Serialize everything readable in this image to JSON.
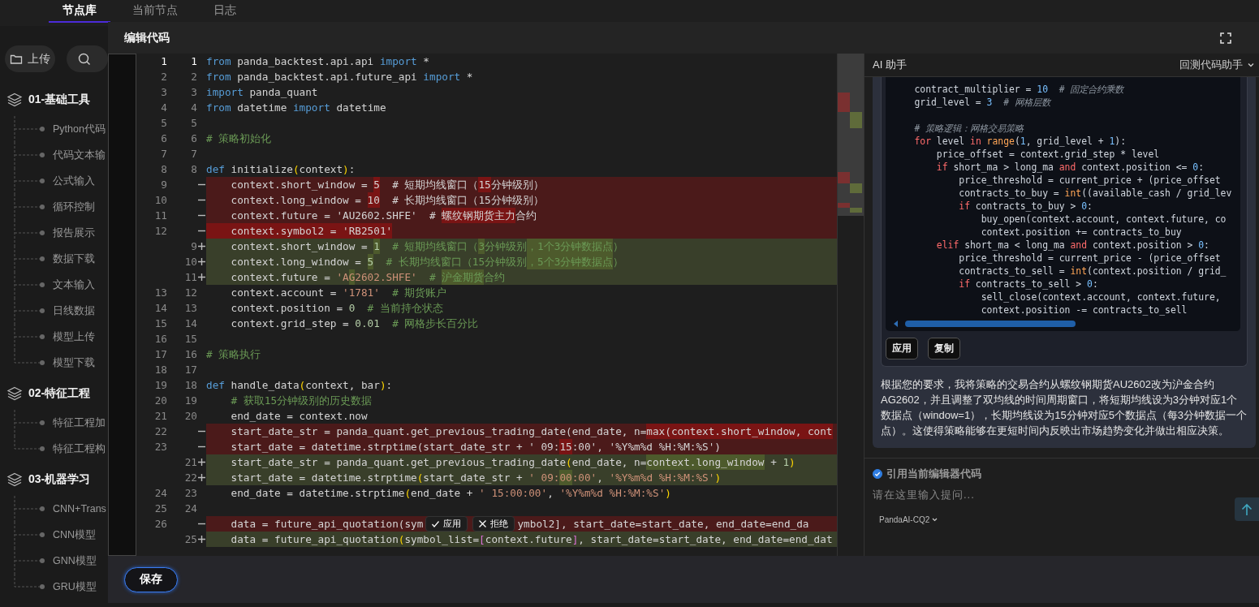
{
  "top_tabs": [
    {
      "label": "节点库",
      "selected": true
    },
    {
      "label": "当前节点",
      "selected": false
    },
    {
      "label": "日志",
      "selected": false
    }
  ],
  "sidebar": {
    "upload_button": "上传",
    "groups": [
      {
        "title": "01-基础工具",
        "children": [
          {
            "label": "Python代码"
          },
          {
            "label": "代码文本输"
          },
          {
            "label": "公式输入"
          },
          {
            "label": "循环控制"
          },
          {
            "label": "报告展示"
          },
          {
            "label": "数据下载"
          },
          {
            "label": "文本输入"
          },
          {
            "label": "日线数据"
          },
          {
            "label": "模型上传"
          },
          {
            "label": "模型下载"
          }
        ]
      },
      {
        "title": "02-特征工程",
        "children": [
          {
            "label": "特征工程加"
          },
          {
            "label": "特征工程构"
          }
        ]
      },
      {
        "title": "03-机器学习",
        "children": [
          {
            "label": "CNN+Trans"
          },
          {
            "label": "CNN模型"
          },
          {
            "label": "GNN模型"
          },
          {
            "label": "GRU模型"
          }
        ]
      }
    ]
  },
  "modal": {
    "title": "编辑代码",
    "save_button": "保存",
    "editor": {
      "lines": [
        {
          "old": "1",
          "new": "1",
          "kind": "context",
          "segs": [
            {
              "kind": "kw",
              "t": "from"
            },
            {
              "kind": "p",
              "t": " panda_backtest.api.api "
            },
            {
              "kind": "kw",
              "t": "import"
            },
            {
              "kind": "p",
              "t": " *"
            }
          ]
        },
        {
          "old": "2",
          "new": "2",
          "kind": "context",
          "segs": [
            {
              "kind": "kw",
              "t": "from"
            },
            {
              "kind": "p",
              "t": " panda_backtest.api.future_api "
            },
            {
              "kind": "kw",
              "t": "import"
            },
            {
              "kind": "p",
              "t": " *"
            }
          ]
        },
        {
          "old": "3",
          "new": "3",
          "kind": "context",
          "segs": [
            {
              "kind": "kw",
              "t": "import"
            },
            {
              "kind": "p",
              "t": " panda_quant"
            }
          ]
        },
        {
          "old": "4",
          "new": "4",
          "kind": "context",
          "segs": [
            {
              "kind": "kw",
              "t": "from"
            },
            {
              "kind": "p",
              "t": " datetime "
            },
            {
              "kind": "kw",
              "t": "import"
            },
            {
              "kind": "p",
              "t": " datetime"
            }
          ]
        },
        {
          "old": "5",
          "new": "5",
          "kind": "context"
        },
        {
          "old": "6",
          "new": "6",
          "kind": "context",
          "segs": [
            {
              "kind": "cmt",
              "t": "# 策略初始化"
            }
          ]
        },
        {
          "old": "7",
          "new": "7",
          "kind": "context"
        },
        {
          "old": "8",
          "new": "8",
          "kind": "context",
          "segs": [
            {
              "kind": "kw",
              "t": "def"
            },
            {
              "kind": "p",
              "t": " initialize"
            },
            {
              "kind": "br",
              "t": "("
            },
            {
              "kind": "p",
              "t": "context"
            },
            {
              "kind": "br",
              "t": ")"
            },
            {
              "kind": "p",
              "t": ":"
            }
          ]
        },
        {
          "old": "9",
          "kind": "removed",
          "segs": [
            {
              "kind": "p",
              "t": "    context.short_window = "
            },
            {
              "kind": "p",
              "t": "5",
              "hl": true
            },
            {
              "kind": "p",
              "t": "  # 短期均线窗口（"
            },
            {
              "kind": "p",
              "t": "15",
              "hl": true
            },
            {
              "kind": "p",
              "t": "分钟级别）"
            }
          ]
        },
        {
          "old": "10",
          "kind": "removed",
          "segs": [
            {
              "kind": "p",
              "t": "    context.long_window = "
            },
            {
              "kind": "p",
              "t": "10",
              "hl": true
            },
            {
              "kind": "p",
              "t": "  # 长期均线窗口（15分钟级别）"
            }
          ]
        },
        {
          "old": "11",
          "kind": "removed",
          "segs": [
            {
              "kind": "p",
              "t": "    context.future = 'AU2602.SHFE'  # "
            },
            {
              "kind": "p",
              "t": "螺纹钢期货主力",
              "hl": true
            },
            {
              "kind": "p",
              "t": "合约"
            }
          ]
        },
        {
          "old": "12",
          "kind": "removed",
          "segs": [
            {
              "kind": "p",
              "t": "    context.symbol2 = 'RB2501'",
              "hl": true
            }
          ]
        },
        {
          "new": "9",
          "kind": "added",
          "segs": [
            {
              "kind": "p",
              "t": "    context.short_window = "
            },
            {
              "kind": "num",
              "t": "1",
              "hl": true
            },
            {
              "kind": "cmt",
              "t": "  # 短期均线窗口（"
            },
            {
              "kind": "cmt",
              "t": "3",
              "hl": true
            },
            {
              "kind": "cmt",
              "t": "分钟级别"
            },
            {
              "kind": "cmt",
              "t": "，1个3分钟数据点",
              "hl": true
            },
            {
              "kind": "cmt",
              "t": "）"
            }
          ]
        },
        {
          "new": "10",
          "kind": "added",
          "segs": [
            {
              "kind": "p",
              "t": "    context.long_window = "
            },
            {
              "kind": "num",
              "t": "5",
              "hl": true
            },
            {
              "kind": "cmt",
              "t": "  # 长期均线窗口（15分钟级别"
            },
            {
              "kind": "cmt",
              "t": "，5个3分钟数据点",
              "hl": true
            },
            {
              "kind": "cmt",
              "t": "）"
            }
          ]
        },
        {
          "new": "11",
          "kind": "added",
          "segs": [
            {
              "kind": "p",
              "t": "    context.future = "
            },
            {
              "kind": "str",
              "t": "'A"
            },
            {
              "kind": "str",
              "t": "G",
              "hl": true
            },
            {
              "kind": "str",
              "t": "2602.SHFE'"
            },
            {
              "kind": "cmt",
              "t": "  # "
            },
            {
              "kind": "cmt",
              "t": "沪金期货",
              "hl": true
            },
            {
              "kind": "cmt",
              "t": "合约"
            }
          ]
        },
        {
          "old": "13",
          "new": "12",
          "kind": "context",
          "segs": [
            {
              "kind": "p",
              "t": "    context.account = "
            },
            {
              "kind": "str",
              "t": "'1781'"
            },
            {
              "kind": "cmt",
              "t": "  # 期货账户"
            }
          ]
        },
        {
          "old": "14",
          "new": "13",
          "kind": "context",
          "segs": [
            {
              "kind": "p",
              "t": "    context.position = "
            },
            {
              "kind": "num",
              "t": "0"
            },
            {
              "kind": "cmt",
              "t": "  # 当前持仓状态"
            }
          ]
        },
        {
          "old": "15",
          "new": "14",
          "kind": "context",
          "segs": [
            {
              "kind": "p",
              "t": "    context.grid_step = "
            },
            {
              "kind": "num",
              "t": "0.01"
            },
            {
              "kind": "cmt",
              "t": "  # 网格步长百分比"
            }
          ]
        },
        {
          "old": "16",
          "new": "15",
          "kind": "context"
        },
        {
          "old": "17",
          "new": "16",
          "kind": "context",
          "segs": [
            {
              "kind": "cmt",
              "t": "# 策略执行"
            }
          ]
        },
        {
          "old": "18",
          "new": "17",
          "kind": "context"
        },
        {
          "old": "19",
          "new": "18",
          "kind": "context",
          "segs": [
            {
              "kind": "kw",
              "t": "def"
            },
            {
              "kind": "p",
              "t": " handle_data"
            },
            {
              "kind": "br",
              "t": "("
            },
            {
              "kind": "p",
              "t": "context, bar"
            },
            {
              "kind": "br",
              "t": ")"
            },
            {
              "kind": "p",
              "t": ":"
            }
          ]
        },
        {
          "old": "20",
          "new": "19",
          "kind": "context",
          "segs": [
            {
              "kind": "cmt",
              "t": "    # 获取15分钟级别的历史数据"
            }
          ]
        },
        {
          "old": "21",
          "new": "20",
          "kind": "context",
          "segs": [
            {
              "kind": "p",
              "t": "    end_date = context.now"
            }
          ]
        },
        {
          "old": "22",
          "kind": "removed",
          "segs": [
            {
              "kind": "p",
              "t": "    start_date_str = panda_quant.get_previous_trading_date(end_date, n="
            },
            {
              "kind": "p",
              "t": "max(context.short_window, cont",
              "hl": true
            }
          ]
        },
        {
          "old": "23",
          "kind": "removed",
          "segs": [
            {
              "kind": "p",
              "t": "    start_date = datetime.strptime(start_date_str + ' 09:"
            },
            {
              "kind": "p",
              "t": "15",
              "hl": true
            },
            {
              "kind": "p",
              "t": ":00', '%Y%m%d %H:%M:%S')"
            }
          ]
        },
        {
          "new": "21",
          "kind": "added",
          "segs": [
            {
              "kind": "p",
              "t": "    start_date_str = panda_quant.get_previous_trading_date"
            },
            {
              "kind": "br",
              "t": "("
            },
            {
              "kind": "p",
              "t": "end_date, n="
            },
            {
              "kind": "p",
              "t": "context.long_window",
              "hl": true
            },
            {
              "kind": "p",
              "t": " + "
            },
            {
              "kind": "num",
              "t": "1"
            },
            {
              "kind": "br",
              "t": ")"
            }
          ]
        },
        {
          "new": "22",
          "kind": "added",
          "segs": [
            {
              "kind": "p",
              "t": "    start_date = datetime.strptime"
            },
            {
              "kind": "br",
              "t": "("
            },
            {
              "kind": "p",
              "t": "start_date_str + "
            },
            {
              "kind": "str",
              "t": "' 09:"
            },
            {
              "kind": "str",
              "t": "00",
              "hl": true
            },
            {
              "kind": "str",
              "t": ":00'"
            },
            {
              "kind": "p",
              "t": ", "
            },
            {
              "kind": "str",
              "t": "'%Y%m%d %H:%M:%S'"
            },
            {
              "kind": "br",
              "t": ")"
            }
          ]
        },
        {
          "old": "24",
          "new": "23",
          "kind": "context",
          "segs": [
            {
              "kind": "p",
              "t": "    end_date = datetime.strptime"
            },
            {
              "kind": "br",
              "t": "("
            },
            {
              "kind": "p",
              "t": "end_date + "
            },
            {
              "kind": "str",
              "t": "' 15:00:00'"
            },
            {
              "kind": "p",
              "t": ", "
            },
            {
              "kind": "str",
              "t": "'%Y%m%d %H:%M:%S'"
            },
            {
              "kind": "br",
              "t": ")"
            }
          ]
        },
        {
          "old": "25",
          "new": "24",
          "kind": "context"
        },
        {
          "old": "26",
          "kind": "removed",
          "segs": [
            {
              "kind": "p",
              "t": "    data = future_api_quotation(sym"
            }
          ],
          "actions": [
            {
              "label": "应用",
              "kind": "accept"
            },
            {
              "label": "拒绝",
              "kind": "reject"
            }
          ],
          "segs_after": [
            {
              "kind": "p",
              "t": "ymbol2], start_date=start_date, end_date=end_da"
            }
          ]
        },
        {
          "new": "25",
          "kind": "added",
          "segs": [
            {
              "kind": "p",
              "t": "    data = future_api_quotation"
            },
            {
              "kind": "br",
              "t": "("
            },
            {
              "kind": "p",
              "t": "symbol_list="
            },
            {
              "kind": "sq",
              "t": "["
            },
            {
              "kind": "p",
              "t": "context.future"
            },
            {
              "kind": "sq",
              "t": "]"
            },
            {
              "kind": "p",
              "t": ", start_date=start_date, end_date=end_dat"
            }
          ]
        }
      ]
    }
  },
  "ai": {
    "title": "AI 助手",
    "mode": "回测代码助手",
    "code": [
      {
        "kind": "code",
        "segs": [
          {
            "kind": "p",
            "t": "    contract_multiplier = "
          },
          {
            "kind": "num",
            "t": "10"
          },
          {
            "kind": "cmt",
            "t": "  # 固定合约乘数"
          }
        ]
      },
      {
        "kind": "code",
        "segs": [
          {
            "kind": "p",
            "t": "    grid_level = "
          },
          {
            "kind": "num",
            "t": "3"
          },
          {
            "kind": "cmt",
            "t": "  # 网格层数"
          }
        ]
      },
      {
        "kind": "blank"
      },
      {
        "kind": "code",
        "segs": [
          {
            "kind": "cmt",
            "t": "    # 策略逻辑：网格交易策略"
          }
        ]
      },
      {
        "kind": "code",
        "segs": [
          {
            "kind": "kw",
            "t": "    for"
          },
          {
            "kind": "p",
            "t": " level "
          },
          {
            "kind": "kw",
            "t": "in"
          },
          {
            "kind": "fn",
            "t": " range"
          },
          {
            "kind": "p",
            "t": "("
          },
          {
            "kind": "num",
            "t": "1"
          },
          {
            "kind": "p",
            "t": ", grid_level + "
          },
          {
            "kind": "num",
            "t": "1"
          },
          {
            "kind": "p",
            "t": "):"
          }
        ]
      },
      {
        "kind": "code",
        "segs": [
          {
            "kind": "p",
            "t": "        price_offset = context.grid_step * level"
          }
        ]
      },
      {
        "kind": "code",
        "segs": [
          {
            "kind": "kw",
            "t": "        if"
          },
          {
            "kind": "p",
            "t": " short_ma > long_ma "
          },
          {
            "kind": "kw",
            "t": "and"
          },
          {
            "kind": "p",
            "t": " context.position <= "
          },
          {
            "kind": "num",
            "t": "0"
          },
          {
            "kind": "p",
            "t": ":"
          }
        ]
      },
      {
        "kind": "code",
        "segs": [
          {
            "kind": "p",
            "t": "            price_threshold = current_price + (price_offset"
          }
        ]
      },
      {
        "kind": "code",
        "segs": [
          {
            "kind": "p",
            "t": "            contracts_to_buy = "
          },
          {
            "kind": "fn",
            "t": "int"
          },
          {
            "kind": "p",
            "t": "((available_cash / grid_lev"
          }
        ]
      },
      {
        "kind": "code",
        "segs": [
          {
            "kind": "kw",
            "t": "            if"
          },
          {
            "kind": "p",
            "t": " contracts_to_buy > "
          },
          {
            "kind": "num",
            "t": "0"
          },
          {
            "kind": "p",
            "t": ":"
          }
        ]
      },
      {
        "kind": "code",
        "segs": [
          {
            "kind": "p",
            "t": "                buy_open(context.account, context.future, co"
          }
        ]
      },
      {
        "kind": "code",
        "segs": [
          {
            "kind": "p",
            "t": "                context.position += contracts_to_buy"
          }
        ]
      },
      {
        "kind": "code",
        "segs": [
          {
            "kind": "kw",
            "t": "        elif"
          },
          {
            "kind": "p",
            "t": " short_ma < long_ma "
          },
          {
            "kind": "kw",
            "t": "and"
          },
          {
            "kind": "p",
            "t": " context.position > "
          },
          {
            "kind": "num",
            "t": "0"
          },
          {
            "kind": "p",
            "t": ":"
          }
        ]
      },
      {
        "kind": "code",
        "segs": [
          {
            "kind": "p",
            "t": "            price_threshold = current_price - (price_offset"
          }
        ]
      },
      {
        "kind": "code",
        "segs": [
          {
            "kind": "p",
            "t": "            contracts_to_sell = "
          },
          {
            "kind": "fn",
            "t": "int"
          },
          {
            "kind": "p",
            "t": "(context.position / grid_"
          }
        ]
      },
      {
        "kind": "code",
        "segs": [
          {
            "kind": "kw",
            "t": "            if"
          },
          {
            "kind": "p",
            "t": " contracts_to_sell > "
          },
          {
            "kind": "num",
            "t": "0"
          },
          {
            "kind": "p",
            "t": ":"
          }
        ]
      },
      {
        "kind": "code",
        "segs": [
          {
            "kind": "p",
            "t": "                sell_close(context.account, context.future,"
          }
        ]
      },
      {
        "kind": "code",
        "segs": [
          {
            "kind": "p",
            "t": "                context.position -= contracts_to_sell"
          }
        ]
      }
    ],
    "code_buttons": [
      "应用",
      "复制"
    ],
    "message": "根据您的要求，我将策略的交易合约从螺纹钢期货AU2602改为沪金合约AG2602，并且调整了双均线的时间周期窗口，将短期均线设为3分钟对应1个数据点（window=1），长期均线设为15分钟对应5个数据点（每3分钟数据一个点）。这使得策略能够在更短时间内反映出市场趋势变化并做出相应决策。",
    "reference": {
      "label": "引用当前编辑器代码",
      "checked": true
    },
    "input": {
      "placeholder": "请在这里输入提问..."
    },
    "model": "PandaAI-CQ2"
  }
}
